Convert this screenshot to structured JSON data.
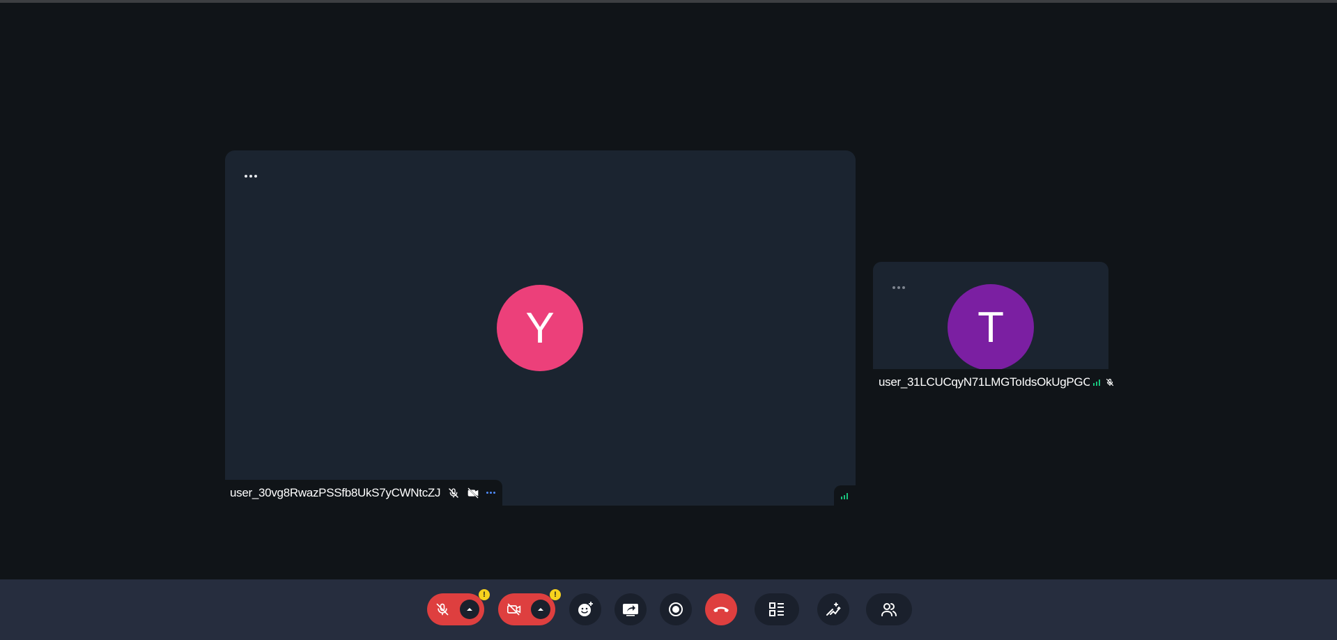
{
  "participants": [
    {
      "name": "user_30vg8RwazPSSfb8UkS7yCWNtcZJ",
      "initial": "Y",
      "avatar_color": "#ec407a",
      "mic": "muted",
      "camera": "off"
    },
    {
      "name": "user_31LCUCqyN71LMGToIdsOkUgPGC",
      "initial": "T",
      "avatar_color": "#7b1fa2",
      "mic": "muted"
    }
  ],
  "toolbar": {
    "buttons": [
      {
        "name": "microphone",
        "icon": "mic-off-icon",
        "state": "muted",
        "warning": "!"
      },
      {
        "name": "camera",
        "icon": "camera-off-icon",
        "state": "off",
        "warning": "!"
      },
      {
        "name": "reactions",
        "icon": "emoji-icon"
      },
      {
        "name": "share-screen",
        "icon": "screen-share-icon"
      },
      {
        "name": "record",
        "icon": "record-icon"
      },
      {
        "name": "leave-call",
        "icon": "hang-up-icon"
      },
      {
        "name": "layout",
        "icon": "layout-icon"
      },
      {
        "name": "effects",
        "icon": "magic-wand-icon"
      },
      {
        "name": "participants",
        "icon": "people-icon"
      }
    ]
  },
  "colors": {
    "background": "#101418",
    "tile": "#1b2430",
    "toolbar": "#262d3e",
    "danger": "#de3f3f",
    "warning": "#f7d21d",
    "signal": "#19c37d",
    "accent": "#4f8cff"
  }
}
